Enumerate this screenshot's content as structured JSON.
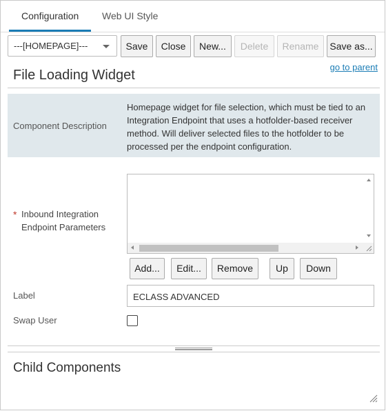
{
  "tabs": [
    {
      "label": "Configuration",
      "active": true
    },
    {
      "label": "Web UI Style",
      "active": false
    }
  ],
  "toolbar": {
    "select_value": "---[HOMEPAGE]---",
    "save": "Save",
    "close": "Close",
    "new": "New...",
    "delete": "Delete",
    "rename": "Rename",
    "save_as": "Save as..."
  },
  "go_to_parent": "go to parent",
  "page_title": "File Loading Widget",
  "description": {
    "label": "Component Description",
    "text": "Homepage widget for file selection, which must be tied to an Integration Endpoint that uses a hotfolder-based receiver method. Will deliver selected files to the hotfolder to be processed per the endpoint configuration."
  },
  "parameters": {
    "required_mark": "*",
    "label": "Inbound Integration Endpoint Parameters",
    "buttons": {
      "add": "Add...",
      "edit": "Edit...",
      "remove": "Remove",
      "up": "Up",
      "down": "Down"
    }
  },
  "label_field": {
    "label": "Label",
    "value": "ECLASS ADVANCED"
  },
  "swap_user": {
    "label": "Swap User",
    "checked": false
  },
  "child_components": "Child Components",
  "colors": {
    "accent": "#1a7cb5",
    "desc_bg": "#e0e8ec",
    "required": "#c0392b"
  }
}
